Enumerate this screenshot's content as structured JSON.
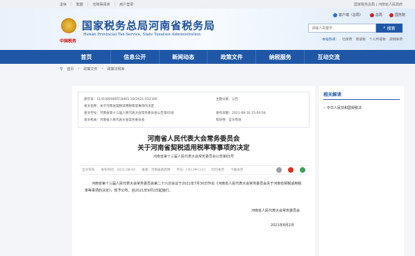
{
  "topbar": {
    "links": [
      "退休",
      "繁體",
      "无障碍阅读",
      "用户登录"
    ],
    "right": "国家税务总局 | 河南省人民政府"
  },
  "header": {
    "title": "国家税务总局河南省税务局",
    "subtitle": "Henan Provincial Tax Service, State Taxation Administration",
    "seal": "中国税务",
    "links": [
      {
        "label": "客户端（总局）",
        "color": "#2a6fd6"
      },
      {
        "label": "总局",
        "color": "#c62828"
      },
      {
        "label": "国务院",
        "color": "#c62828"
      }
    ],
    "search_placeholder": "请输入关键字",
    "search_button": "搜索",
    "hot_label": "本站热词：",
    "hot_words": [
      "社保费",
      "增值税",
      "个人所得税",
      "减税降费"
    ]
  },
  "nav": [
    "首页",
    "信息公开",
    "新闻动态",
    "政策文件",
    "纳税服务",
    "互动交流"
  ],
  "breadcrumb": [
    "首页",
    "政策文件",
    "政策法规库"
  ],
  "meta": {
    "rows": [
      [
        "索引号：1141000000518461 1D/2021-012166",
        "主题分类：公告"
      ],
      [
        "发文名称：关于河南省契税适用税率等事项的决定",
        ""
      ],
      [
        "发文字号：河南省第十三届人民代表大会常务委员会公告第65号",
        "发布日期：2021-08-16 15:00:58"
      ],
      [
        "发文机关：河南省人民代表大会常务委员会",
        "有效性：全文有效"
      ]
    ]
  },
  "doc": {
    "title_line1": "河南省人民代表大会常务委员会",
    "title_line2": "关于河南省契税适用税率等事项的决定",
    "subtitle": "河南省第十三届人民代表大会常务委员会公告第65号",
    "tools": [
      "全文有效",
      "发布时间：2021-08-02",
      "来源：河南省政府网",
      "字号：[大] [中] [小]",
      "打印本页",
      "下载本页"
    ],
    "body": "河南省第十三届人民代表大会常务委员会第二十六次会议于2021年7月30日作出《河南省人民代表大会常务委员会关于河南省契税适用税率等事项的决定》，现予公布，自2021年9月1日起施行。",
    "sign": "河南省人民代表大会常务委员会",
    "date": "2021年8月2日",
    "share_colors": [
      "#9aa0a6",
      "#d93025",
      "#34a853"
    ]
  },
  "side": {
    "heading": "相关解读",
    "items": [
      "中华人民共和国契税法"
    ]
  },
  "colors": {
    "brand": "#1f57a6",
    "title": "#1c4f98"
  }
}
